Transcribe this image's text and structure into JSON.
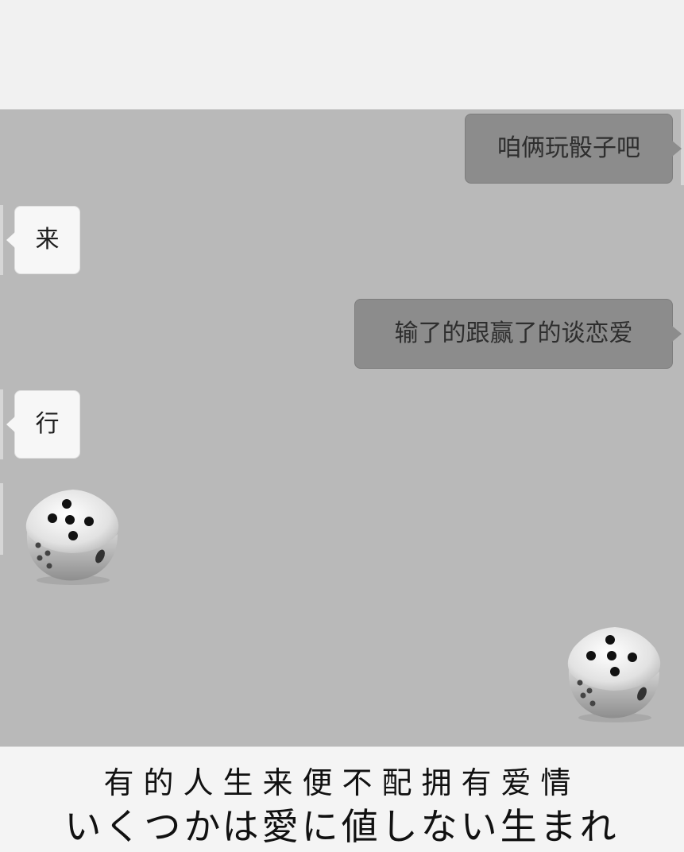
{
  "messages": [
    {
      "side": "sent",
      "text": "咱俩玩骰子吧"
    },
    {
      "side": "received",
      "text": "来"
    },
    {
      "side": "sent",
      "text": "输了的跟赢了的谈恋爱"
    },
    {
      "side": "received",
      "text": "行"
    },
    {
      "side": "received",
      "type": "dice",
      "face_value": 5,
      "icon": "dice-icon"
    },
    {
      "side": "sent",
      "type": "dice",
      "face_value": 5,
      "icon": "dice-icon"
    }
  ],
  "caption": {
    "line_cn": "有的人生来便不配拥有爱情",
    "line_jp": "いくつかは愛に値しない生まれ"
  },
  "colors": {
    "chat_background": "#b9b9b9",
    "sent_bubble": "#8c8c8c",
    "received_bubble": "#f7f7f7",
    "page_background": "#f1f1f1"
  }
}
